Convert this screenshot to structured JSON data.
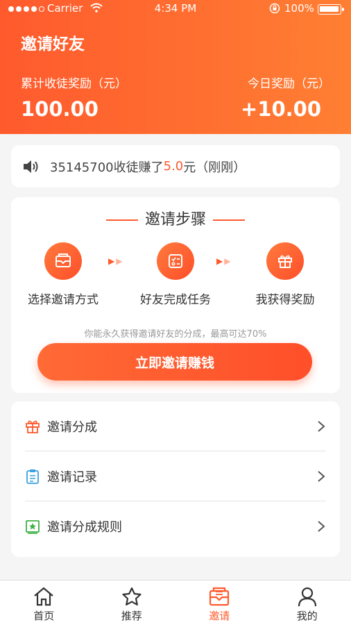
{
  "status_bar": {
    "carrier": "Carrier",
    "time": "4:34 PM",
    "battery": "100%"
  },
  "header": {
    "title": "邀请好友",
    "total_label": "累计收徒奖励（元）",
    "total_value": "100.00",
    "today_label": "今日奖励（元）",
    "today_value": "+10.00"
  },
  "notice": {
    "prefix": "35145700收徒赚了",
    "amount": "5.0",
    "suffix": "元（刚刚）"
  },
  "steps": {
    "title": "邀请步骤",
    "items": [
      {
        "label": "选择邀请方式",
        "icon": "envelope-icon"
      },
      {
        "label": "好友完成任务",
        "icon": "task-list-icon"
      },
      {
        "label": "我获得奖励",
        "icon": "gift-icon"
      }
    ],
    "hint": "你能永久获得邀请好友的分成，最高可达70%",
    "cta": "立即邀请赚钱"
  },
  "menu": {
    "items": [
      {
        "label": "邀请分成",
        "icon": "gift-icon"
      },
      {
        "label": "邀请记录",
        "icon": "clipboard-icon"
      },
      {
        "label": "邀请分成规则",
        "icon": "rules-icon"
      }
    ]
  },
  "tabbar": {
    "items": [
      {
        "label": "首页",
        "icon": "home-icon"
      },
      {
        "label": "推荐",
        "icon": "star-icon"
      },
      {
        "label": "邀请",
        "icon": "invite-icon"
      },
      {
        "label": "我的",
        "icon": "user-icon"
      }
    ],
    "active": "邀请"
  },
  "colors": {
    "accent": "#ff5a2d",
    "accent_light": "#ff7f33"
  }
}
